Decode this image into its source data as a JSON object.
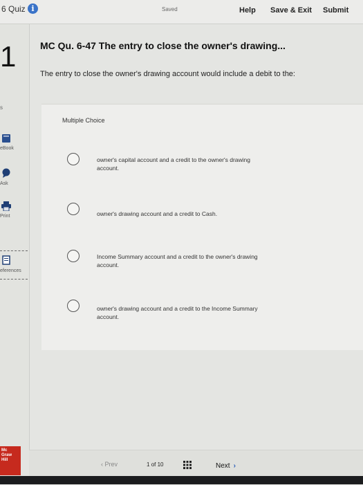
{
  "header": {
    "quiz_title": "6 Quiz",
    "saved": "Saved",
    "help": "Help",
    "save_exit": "Save & Exit",
    "submit": "Submit"
  },
  "rail": {
    "question_number": "1",
    "score_fragment": "s",
    "items": [
      {
        "label": "eBook",
        "icon": "book-icon"
      },
      {
        "label": "Ask",
        "icon": "chat-icon"
      },
      {
        "label": "Print",
        "icon": "print-icon"
      },
      {
        "label": "eferences",
        "icon": "document-icon"
      }
    ],
    "logo_lines": [
      "Mc",
      "Graw",
      "Hill"
    ]
  },
  "question": {
    "title": "MC Qu. 6-47 The entry to close the owner's drawing...",
    "text": "The entry to close the owner's drawing account would include a debit to the:",
    "type_label": "Multiple Choice",
    "options": [
      "owner's capital account and a credit to the owner's drawing account.",
      "owner's drawing account and a credit to Cash.",
      "Income Summary account and a credit to the owner's drawing account.",
      "owner's drawing account and a credit to the Income Summary account."
    ]
  },
  "footer": {
    "prev": "Prev",
    "page_current": "1",
    "page_of": "of",
    "page_total": "10",
    "next": "Next"
  },
  "colors": {
    "accent": "#2a5db8",
    "info": "#3a73c8",
    "logo": "#c62a1e"
  }
}
